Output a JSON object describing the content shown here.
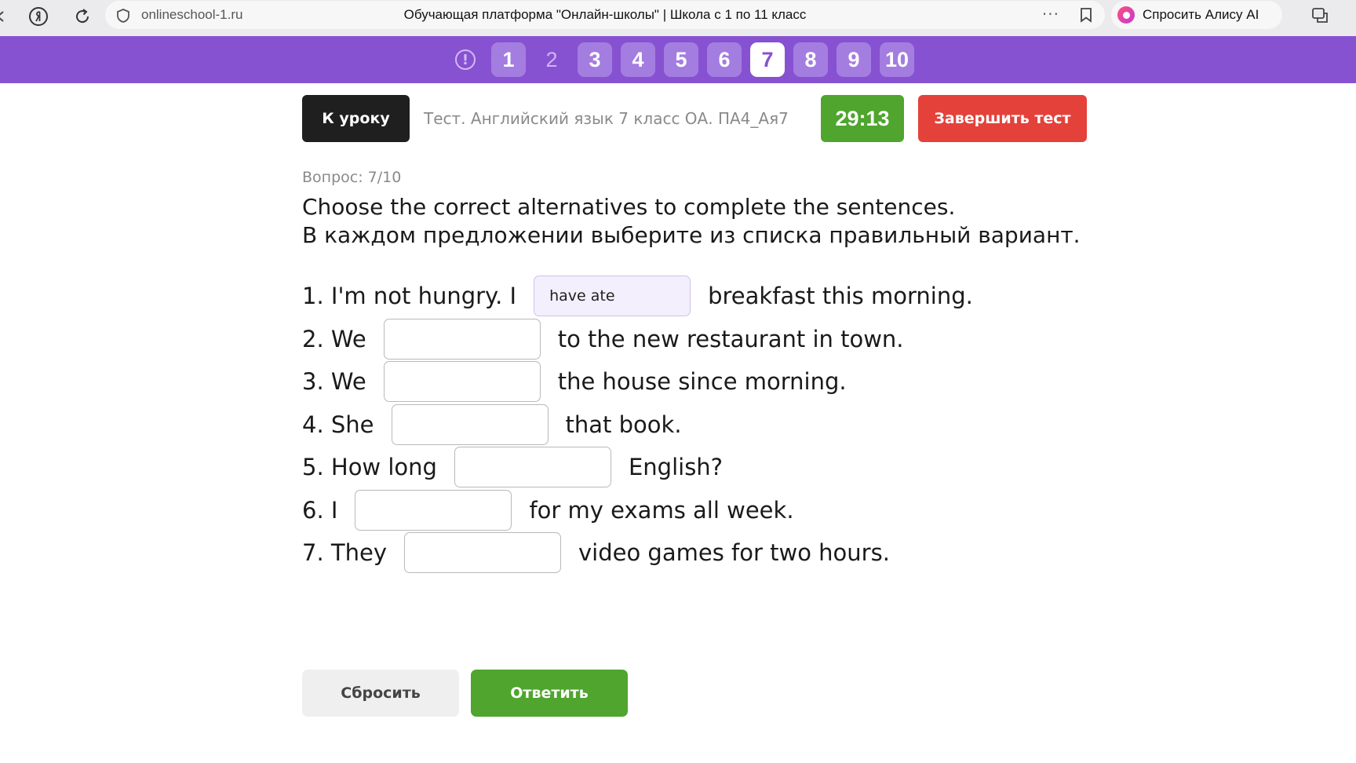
{
  "browser": {
    "host": "onlineschool-1.ru",
    "page_title": "Обучающая платформа \"Онлайн-школы\" | Школа с 1 по 11 класс",
    "dots": "···",
    "alice_label": "Спросить Алису AI"
  },
  "question_nav": {
    "info_symbol": "!",
    "items": [
      {
        "label": "1",
        "state": "answered"
      },
      {
        "label": "2",
        "state": "unanswered"
      },
      {
        "label": "3",
        "state": "answered"
      },
      {
        "label": "4",
        "state": "answered"
      },
      {
        "label": "5",
        "state": "answered"
      },
      {
        "label": "6",
        "state": "answered"
      },
      {
        "label": "7",
        "state": "current"
      },
      {
        "label": "8",
        "state": "answered"
      },
      {
        "label": "9",
        "state": "answered"
      },
      {
        "label": "10",
        "state": "answered"
      }
    ]
  },
  "header": {
    "back_label": "К уроку",
    "test_title": "Тест. Английский язык 7 класс ОА. ПА4_Ая7",
    "timer": "29:13",
    "finish_label": "Завершить тест"
  },
  "question": {
    "counter": "Вопрос: 7/10",
    "instruction_en": "Choose the correct alternatives to complete the sentences.",
    "instruction_ru": "В каждом предложении выберите из списка правильный вариант.",
    "sentences": [
      {
        "pre": "1. I'm not hungry. I",
        "value": "have ate",
        "post": "breakfast this morning."
      },
      {
        "pre": "2. We",
        "value": "",
        "post": "to the new restaurant in town."
      },
      {
        "pre": "3. We",
        "value": "",
        "post": "the house since morning."
      },
      {
        "pre": "4. She",
        "value": "",
        "post": "that book."
      },
      {
        "pre": "5. How long",
        "value": "",
        "post": "English?"
      },
      {
        "pre": "6. I",
        "value": "",
        "post": "for my exams all week."
      },
      {
        "pre": "7. They",
        "value": "",
        "post": "video games for two hours."
      }
    ]
  },
  "actions": {
    "reset_label": "Сбросить",
    "answer_label": "Ответить"
  },
  "colors": {
    "nav_bg": "#8752d1",
    "timer_green": "#4fa52e",
    "finish_red": "#e4413b"
  }
}
